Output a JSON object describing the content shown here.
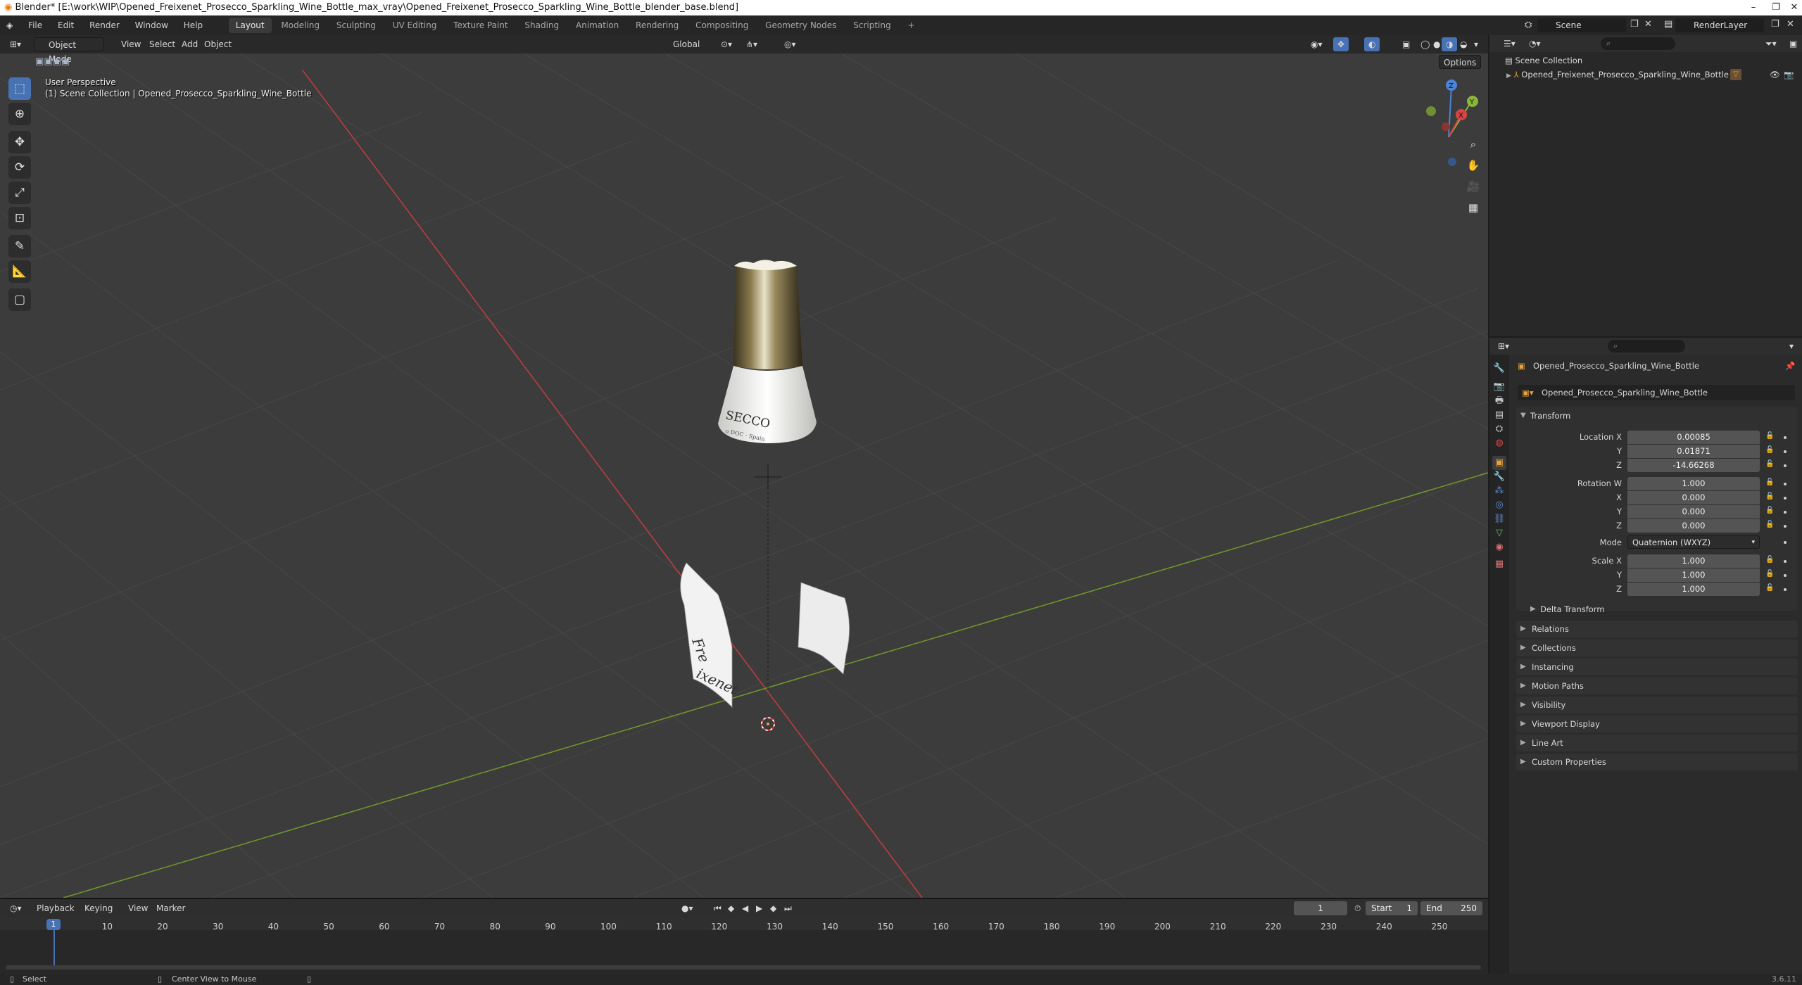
{
  "window": {
    "title": "Blender* [E:\\work\\WIP\\Opened_Freixenet_Prosecco_Sparkling_Wine_Bottle_max_vray\\Opened_Freixenet_Prosecco_Sparkling_Wine_Bottle_blender_base.blend]",
    "minimize": "–",
    "maximize": "❐",
    "close": "✕"
  },
  "menu": [
    "File",
    "Edit",
    "Render",
    "Window",
    "Help"
  ],
  "workspaces": {
    "tabs": [
      "Layout",
      "Modeling",
      "Sculpting",
      "UV Editing",
      "Texture Paint",
      "Shading",
      "Animation",
      "Rendering",
      "Compositing",
      "Geometry Nodes",
      "Scripting"
    ],
    "active": "Layout",
    "add": "+"
  },
  "scene": {
    "name": "Scene",
    "view_layer": "RenderLayer"
  },
  "viewport": {
    "mode": "Object Mode",
    "menus": [
      "View",
      "Select",
      "Add",
      "Object"
    ],
    "orientation": "Global",
    "options": "Options",
    "perspective_label": "User Perspective",
    "collection_label": "(1) Scene Collection | Opened_Prosecco_Sparkling_Wine_Bottle",
    "label_text_left": "Fre",
    "label_text_mid": "ixenet",
    "bottle_text": "SECCO",
    "bottle_subtext": "o DOC · Spain",
    "colors": {
      "background": "#3c3c3c",
      "x_axis": "#c43d3d",
      "y_axis": "#6f9a2a",
      "active_tool": "#4772b3"
    }
  },
  "timeline": {
    "menus": [
      "Playback",
      "Keying",
      "View",
      "Marker"
    ],
    "current_frame": "1",
    "start_label": "Start",
    "start": "1",
    "end_label": "End",
    "end": "250",
    "ticks": [
      "10",
      "20",
      "30",
      "40",
      "50",
      "60",
      "70",
      "80",
      "90",
      "100",
      "110",
      "120",
      "130",
      "140",
      "150",
      "160",
      "170",
      "180",
      "190",
      "200",
      "210",
      "220",
      "230",
      "240",
      "250"
    ]
  },
  "outliner": {
    "root": "Scene Collection",
    "object": "Opened_Freixenet_Prosecco_Sparkling_Wine_Bottle"
  },
  "properties": {
    "object_name": "Opened_Prosecco_Sparkling_Wine_Bottle",
    "data_name": "Opened_Prosecco_Sparkling_Wine_Bottle",
    "transform_title": "Transform",
    "location": {
      "label": "Location X",
      "x": "0.00085",
      "y": "0.01871",
      "z": "-14.66268"
    },
    "rotation": {
      "label": "Rotation W",
      "w": "1.000",
      "x": "0.000",
      "y": "0.000",
      "z": "0.000"
    },
    "mode_label": "Mode",
    "mode": "Quaternion (WXYZ)",
    "scale": {
      "label": "Scale X",
      "x": "1.000",
      "y": "1.000",
      "z": "1.000"
    },
    "axis_labels": {
      "y": "Y",
      "z": "Z",
      "x": "X"
    },
    "delta_transform": "Delta Transform",
    "panels": [
      "Relations",
      "Collections",
      "Instancing",
      "Motion Paths",
      "Visibility",
      "Viewport Display",
      "Line Art",
      "Custom Properties"
    ]
  },
  "statusbar": {
    "select": "Select",
    "center": "Center View to Mouse",
    "version": "3.6.11"
  }
}
